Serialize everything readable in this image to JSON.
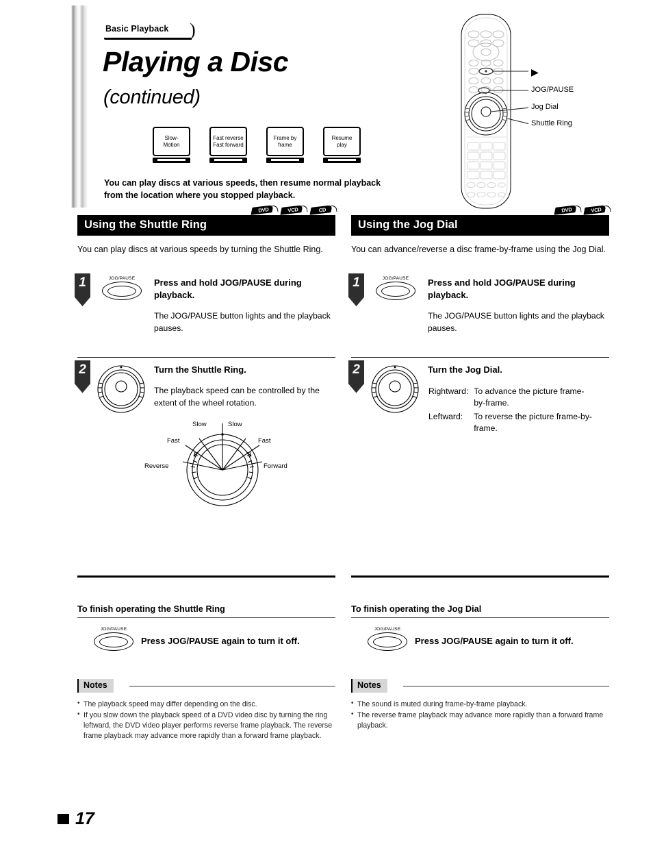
{
  "header": {
    "kicker": "Basic Playback",
    "title": "Playing a Disc",
    "subtitle": "(continued)"
  },
  "feature_icons": [
    {
      "name": "slow-motion",
      "line1": "Slow-",
      "line2": "Motion"
    },
    {
      "name": "fast-reverse-forward",
      "line1": "Fast reverse",
      "line2": "Fast forward"
    },
    {
      "name": "frame-by-frame",
      "line1": "Frame by",
      "line2": "frame"
    },
    {
      "name": "resume-play",
      "line1": "Resume",
      "line2": "play"
    }
  ],
  "lead": "You can play discs at various speeds, then resume normal playback from the location where you stopped playback.",
  "remote": {
    "callouts": [
      {
        "label": "▶",
        "name": "play-button-callout"
      },
      {
        "label": "JOG/PAUSE",
        "name": "jog-pause-callout"
      },
      {
        "label": "Jog Dial",
        "name": "jog-dial-callout"
      },
      {
        "label": "Shuttle Ring",
        "name": "shuttle-ring-callout"
      }
    ]
  },
  "left_column": {
    "section_title": "Using the Shuttle Ring",
    "badges": [
      "DVD",
      "VCD",
      "CD"
    ],
    "intro": "You can play discs at various speeds by turning the Shuttle Ring.",
    "steps": [
      {
        "number": "1",
        "button_label": "JOG/PAUSE",
        "title": "Press and hold JOG/PAUSE during playback.",
        "text": "The JOG/PAUSE button lights and the playback pauses."
      },
      {
        "number": "2",
        "title": "Turn the Shuttle Ring.",
        "text": "The playback speed can be controlled by the extent of the wheel rotation."
      }
    ],
    "speed_diagram": {
      "slow_left": "Slow",
      "slow_right": "Slow",
      "fast_left": "Fast",
      "fast_right": "Fast",
      "reverse": "Reverse",
      "forward": "Forward"
    },
    "finish": {
      "title": "To finish operating the Shuttle Ring",
      "button_label": "JOG/PAUSE",
      "text": "Press JOG/PAUSE again to turn it off."
    },
    "notes": {
      "heading": "Notes",
      "items": [
        "The playback speed may differ depending on the disc.",
        "If you slow down the playback speed of a DVD video disc by turning the ring leftward, the DVD video player performs reverse frame playback. The reverse frame playback may advance more rapidly than a forward frame playback."
      ]
    }
  },
  "right_column": {
    "section_title": "Using the Jog Dial",
    "badges": [
      "DVD",
      "VCD"
    ],
    "intro": "You can advance/reverse a disc frame-by-frame using the Jog Dial.",
    "steps": [
      {
        "number": "1",
        "button_label": "JOG/PAUSE",
        "title": "Press and hold JOG/PAUSE during playback.",
        "text": "The JOG/PAUSE button lights and the playback pauses."
      },
      {
        "number": "2",
        "title": "Turn the Jog Dial.",
        "directions": [
          {
            "term": "Rightward:",
            "desc": "To advance the picture frame-by-frame."
          },
          {
            "term": "Leftward:",
            "desc": "To reverse the picture frame-by-frame."
          }
        ]
      }
    ],
    "finish": {
      "title": "To finish operating the Jog Dial",
      "button_label": "JOG/PAUSE",
      "text": "Press JOG/PAUSE again to turn it off."
    },
    "notes": {
      "heading": "Notes",
      "items": [
        "The sound is muted during frame-by-frame playback.",
        "The reverse frame playback may advance more rapidly than a forward frame playback."
      ]
    }
  },
  "page_number": "17"
}
